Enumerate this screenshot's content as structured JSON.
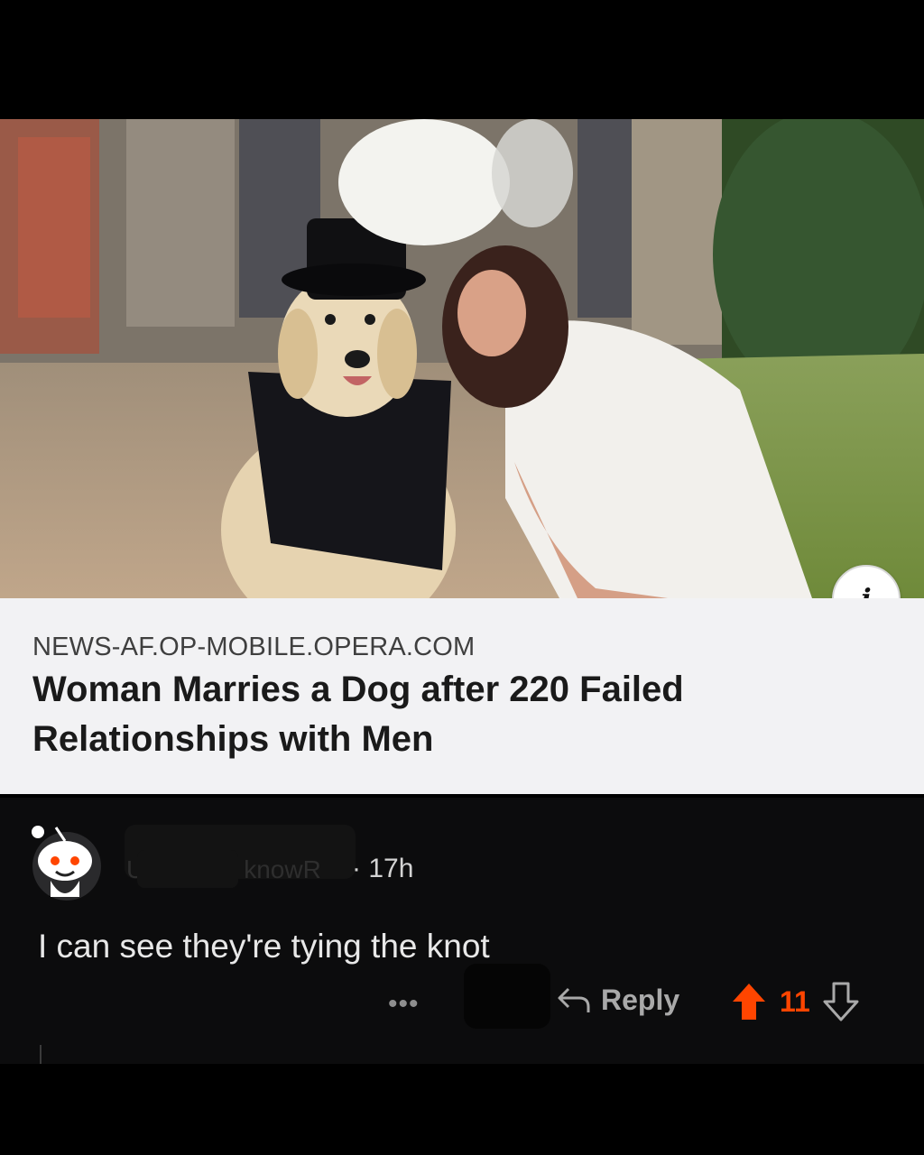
{
  "link_preview": {
    "domain": "NEWS-AF.OP-MOBILE.OPERA.COM",
    "headline": "Woman Marries a Dog after 220 Failed Relationships with Men",
    "info_icon": "info-icon"
  },
  "comment": {
    "avatar_icon": "reddit-snoo-avatar",
    "author_visible": "knowR",
    "age": "· 17h",
    "text": "I can see they're tying the knot",
    "more_label": "•••",
    "reply_label": "Reply",
    "score": "11",
    "colors": {
      "upvote": "#ff4500",
      "background": "#0c0c0d"
    }
  }
}
